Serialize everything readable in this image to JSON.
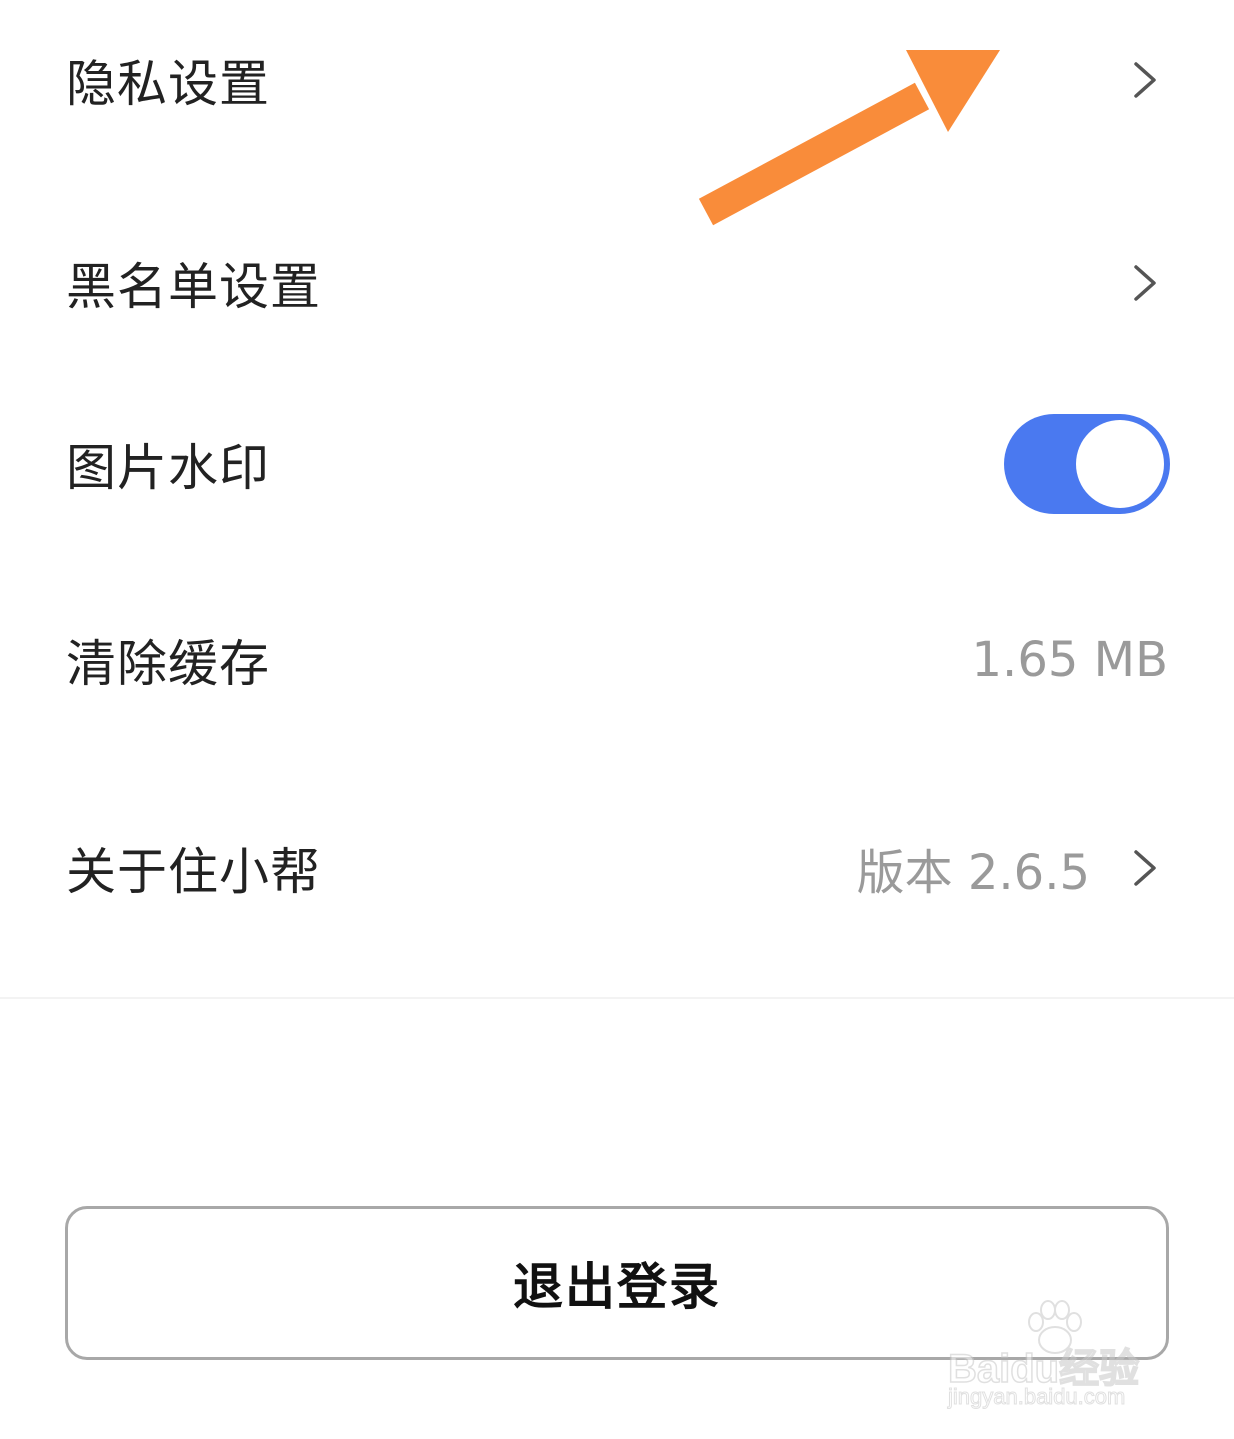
{
  "settings": {
    "items": [
      {
        "label": "隐私设置"
      },
      {
        "label": "黑名单设置"
      },
      {
        "label": "图片水印",
        "toggle_on": true
      },
      {
        "label": "清除缓存",
        "value": "1.65 MB"
      },
      {
        "label": "关于住小帮",
        "value": "版本 2.6.5"
      }
    ]
  },
  "logout": {
    "label": "退出登录"
  },
  "watermark": {
    "brand": "Baidu经验",
    "url": "jingyan.baidu.com"
  },
  "colors": {
    "toggle_on": "#4a79f0",
    "annotation_arrow": "#f98c3a",
    "chevron": "#555555",
    "secondary_text": "#9a9a9a"
  },
  "icons": {
    "chevron": "chevron-right-icon",
    "annotation": "arrow-annotation-icon",
    "watermark": "baidu-paw-icon"
  }
}
